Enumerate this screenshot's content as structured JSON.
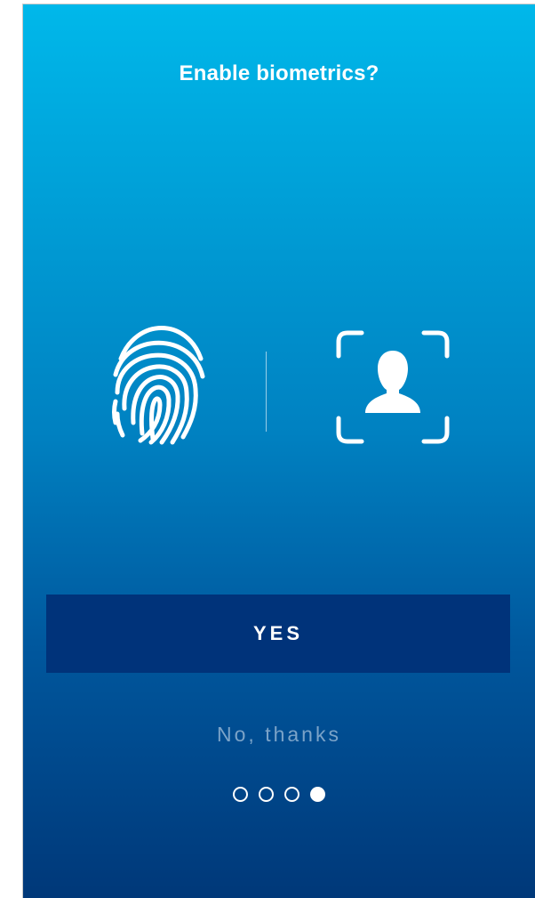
{
  "title": "Enable biometrics?",
  "icons": {
    "fingerprint": "fingerprint-icon",
    "face": "face-id-icon"
  },
  "actions": {
    "yes_label": "YES",
    "no_label": "No, thanks"
  },
  "pager": {
    "total": 4,
    "current": 4
  },
  "colors": {
    "gradient_top": "#00b8ea",
    "gradient_bottom": "#003879",
    "yes_button_bg": "#00337a",
    "no_thanks_text": "#7ba3c8"
  }
}
